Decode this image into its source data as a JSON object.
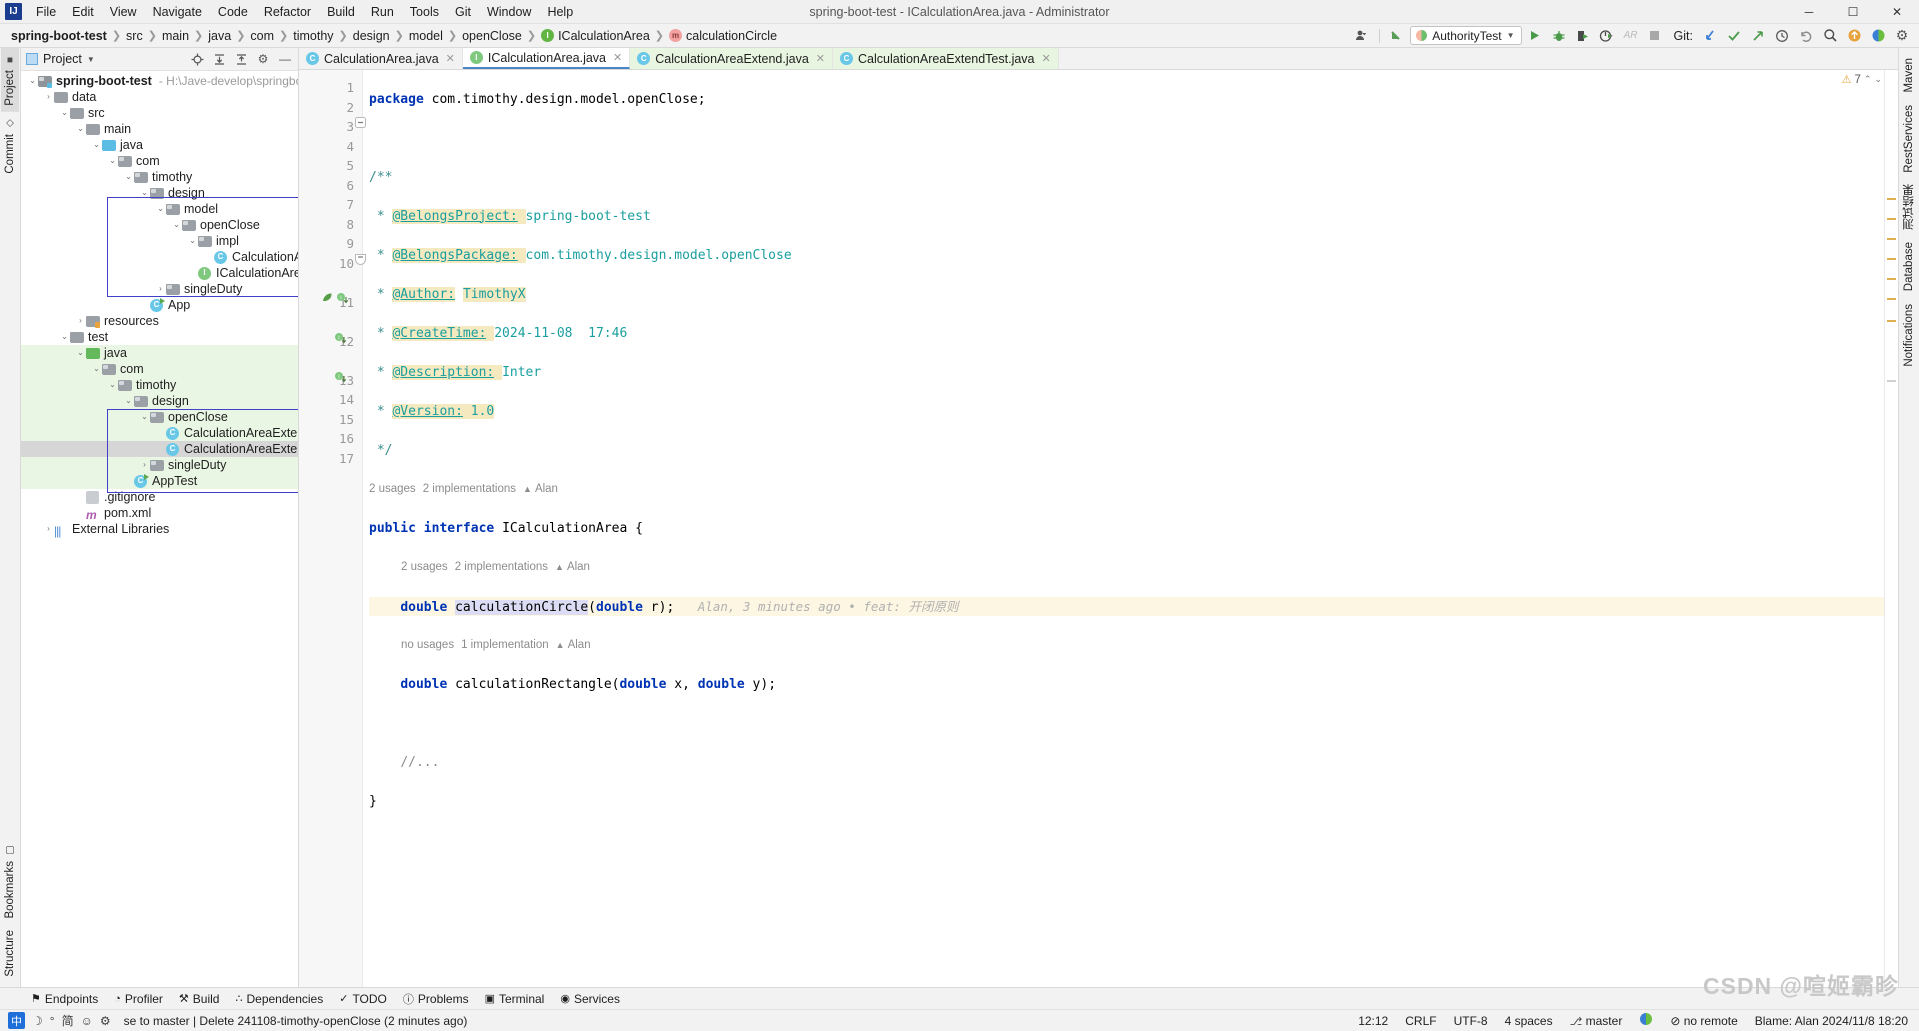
{
  "window": {
    "title": "spring-boot-test - ICalculationArea.java - Administrator",
    "logo": "IJ",
    "minimize": "─",
    "maximize": "☐",
    "close": "✕"
  },
  "menu": [
    "File",
    "Edit",
    "View",
    "Navigate",
    "Code",
    "Refactor",
    "Build",
    "Run",
    "Tools",
    "Git",
    "Window",
    "Help"
  ],
  "breadcrumb": [
    {
      "label": "spring-boot-test",
      "icon": "",
      "bold": true
    },
    {
      "label": "src",
      "icon": ""
    },
    {
      "label": "main",
      "icon": ""
    },
    {
      "label": "java",
      "icon": ""
    },
    {
      "label": "com",
      "icon": ""
    },
    {
      "label": "timothy",
      "icon": ""
    },
    {
      "label": "design",
      "icon": ""
    },
    {
      "label": "model",
      "icon": ""
    },
    {
      "label": "openClose",
      "icon": ""
    },
    {
      "label": "ICalculationArea",
      "icon": "I"
    },
    {
      "label": "calculationCircle",
      "icon": "m"
    }
  ],
  "toolbar": {
    "profile_icon": "person-dropdown-icon",
    "updates_icon": "update-project-icon",
    "run_config": "AuthorityTest",
    "run_icon": "▶",
    "debug_icon": "debug-icon",
    "run_coverage_icon": "run-with-coverage-icon",
    "profiler_icon": "profiler-icon",
    "attach_icon": "AR",
    "stop_icon": "■",
    "git_label": "Git:",
    "git_update_icon": "↙",
    "git_commit_icon": "✓",
    "git_push_icon": "↗",
    "git_history_icon": "◴",
    "git_rollback_icon": "↺",
    "search_icon": "⌕",
    "notification_icon": "↑",
    "ai_icon": "ai-assistant-icon",
    "settings_icon": "⚙"
  },
  "left_rail": {
    "top": [
      "Project",
      "Commit"
    ],
    "bottom": [
      "Bookmarks",
      "Structure"
    ]
  },
  "right_rail": [
    "Maven",
    "RestServices",
    "测试结果",
    "Database",
    "Notifications"
  ],
  "project_panel": {
    "title": "Project",
    "actions": [
      "locate-icon",
      "expand-all-icon",
      "collapse-all-icon",
      "settings-icon",
      "hide-icon"
    ],
    "tree": [
      {
        "depth": 0,
        "arrow": "⌄",
        "icon": "module-folder",
        "label": "spring-boot-test",
        "bold": true,
        "path": "- H:\\Jave-develop\\springboot\\sp"
      },
      {
        "depth": 1,
        "arrow": "›",
        "icon": "folder",
        "label": "data"
      },
      {
        "depth": 1,
        "arrow": "⌄",
        "icon": "folder",
        "label": "src"
      },
      {
        "depth": 2,
        "arrow": "⌄",
        "icon": "folder",
        "label": "main"
      },
      {
        "depth": 3,
        "arrow": "⌄",
        "icon": "source-folder",
        "label": "java"
      },
      {
        "depth": 4,
        "arrow": "⌄",
        "icon": "package",
        "label": "com"
      },
      {
        "depth": 5,
        "arrow": "⌄",
        "icon": "package",
        "label": "timothy"
      },
      {
        "depth": 6,
        "arrow": "⌄",
        "icon": "package",
        "label": "design"
      },
      {
        "depth": 7,
        "arrow": "⌄",
        "icon": "package",
        "label": "model"
      },
      {
        "depth": 8,
        "arrow": "⌄",
        "icon": "package",
        "label": "openClose"
      },
      {
        "depth": 9,
        "arrow": "⌄",
        "icon": "package",
        "label": "impl"
      },
      {
        "depth": 10,
        "arrow": "",
        "icon": "class",
        "label": "CalculationArea"
      },
      {
        "depth": 9,
        "arrow": "",
        "icon": "interface",
        "label": "ICalculationArea"
      },
      {
        "depth": 8,
        "arrow": "›",
        "icon": "package",
        "label": "singleDuty"
      },
      {
        "depth": 7,
        "arrow": "",
        "icon": "runnable-class",
        "label": "App"
      },
      {
        "depth": 3,
        "arrow": "›",
        "icon": "resource-folder",
        "label": "resources"
      },
      {
        "depth": 2,
        "arrow": "⌄",
        "icon": "folder",
        "label": "test"
      },
      {
        "depth": 3,
        "arrow": "⌄",
        "icon": "test-source-folder",
        "label": "java",
        "green": true
      },
      {
        "depth": 4,
        "arrow": "⌄",
        "icon": "package",
        "label": "com",
        "green": true
      },
      {
        "depth": 5,
        "arrow": "⌄",
        "icon": "package",
        "label": "timothy",
        "green": true
      },
      {
        "depth": 6,
        "arrow": "⌄",
        "icon": "package",
        "label": "design",
        "green": true
      },
      {
        "depth": 7,
        "arrow": "⌄",
        "icon": "package",
        "label": "openClose",
        "green": true
      },
      {
        "depth": 8,
        "arrow": "",
        "icon": "class",
        "label": "CalculationAreaExtend",
        "green": true
      },
      {
        "depth": 8,
        "arrow": "",
        "icon": "class",
        "label": "CalculationAreaExtendTest",
        "green": true,
        "selected": true
      },
      {
        "depth": 7,
        "arrow": "›",
        "icon": "package",
        "label": "singleDuty",
        "green": true
      },
      {
        "depth": 6,
        "arrow": "",
        "icon": "runnable-class",
        "label": "AppTest",
        "green": true
      },
      {
        "depth": 1,
        "arrow": "",
        "icon": "gitignore",
        "label": ".gitignore"
      },
      {
        "depth": 1,
        "arrow": "",
        "icon": "maven",
        "label": "pom.xml"
      },
      {
        "depth": 0,
        "arrow": "›",
        "icon": "libraries",
        "label": "External Libraries"
      }
    ]
  },
  "tabs": [
    {
      "label": "CalculationArea.java",
      "icon": "C",
      "kind": "class",
      "active": false,
      "test": false
    },
    {
      "label": "ICalculationArea.java",
      "icon": "I",
      "kind": "interface",
      "active": true,
      "test": false
    },
    {
      "label": "CalculationAreaExtend.java",
      "icon": "C",
      "kind": "class",
      "active": false,
      "test": true
    },
    {
      "label": "CalculationAreaExtendTest.java",
      "icon": "C",
      "kind": "class",
      "active": false,
      "test": true
    }
  ],
  "editor": {
    "warning_count": "7",
    "warning_icon": "⚠",
    "collapse_up_icon": "⌃",
    "collapse_down_icon": "⌄",
    "lines": [
      {
        "n": "1",
        "text": "package com.timothy.design.model.openClose;"
      },
      {
        "n": "2",
        "text": ""
      },
      {
        "n": "3",
        "text": "/**"
      },
      {
        "n": "4",
        "text": " * @BelongsProject: spring-boot-test"
      },
      {
        "n": "5",
        "text": " * @BelongsPackage: com.timothy.design.model.openClose"
      },
      {
        "n": "6",
        "text": " * @Author: TimothyX"
      },
      {
        "n": "7",
        "text": " * @CreateTime: 2024-11-08  17:46"
      },
      {
        "n": "8",
        "text": " * @Description: Inter"
      },
      {
        "n": "9",
        "text": " * @Version: 1.0"
      },
      {
        "n": "10",
        "text": " */"
      },
      {
        "n": "11",
        "text": "public interface ICalculationArea {"
      },
      {
        "n": "12",
        "text": "    double calculationCircle(double r);"
      },
      {
        "n": "13",
        "text": "    double calculationRectangle(double x, double y);"
      },
      {
        "n": "14",
        "text": ""
      },
      {
        "n": "15",
        "text": "    //..."
      },
      {
        "n": "16",
        "text": "}"
      },
      {
        "n": "17",
        "text": ""
      }
    ],
    "doc_tags": [
      {
        "tag": "@BelongsProject:",
        "value": "spring-boot-test"
      },
      {
        "tag": "@BelongsPackage:",
        "value": "com.timothy.design.model.openClose"
      },
      {
        "tag": "@Author:",
        "value": "TimothyX"
      },
      {
        "tag": "@CreateTime:",
        "value": "2024-11-08  17:46"
      },
      {
        "tag": "@Description:",
        "value": "Inter"
      },
      {
        "tag": "@Version:",
        "value": "1.0"
      }
    ],
    "code_vision": [
      {
        "usages": "2 usages",
        "impls": "2 implementations",
        "author": "Alan"
      },
      {
        "usages": "2 usages",
        "impls": "2 implementations",
        "author": "Alan"
      },
      {
        "usages": "no usages",
        "impls": "1 implementation",
        "author": "Alan"
      }
    ],
    "blame_annotation": "Alan, 3 minutes ago • feat: 开闭原则",
    "package_keyword": "package",
    "package_name": "com.timothy.design.model.openClose;",
    "sig_public": "public",
    "sig_interface": "interface",
    "sig_name": "ICalculationArea",
    "sig_brace": "{",
    "m1_type": "double",
    "m1_name": "calculationCircle",
    "m1_params_open": "(",
    "m1_param_type": "double",
    "m1_param_name": " r);",
    "m2_type": "double",
    "m2_name": "calculationRectangle(",
    "m2_p1_type": "double",
    "m2_p1_name": " x, ",
    "m2_p2_type": "double",
    "m2_p2_name": " y);",
    "comment_line": "//...",
    "close_brace": "}"
  },
  "bottom_tools": [
    {
      "label": "Endpoints",
      "icon": "⚑"
    },
    {
      "label": "Profiler",
      "icon": "◔"
    },
    {
      "label": "Build",
      "icon": "⚒"
    },
    {
      "label": "Dependencies",
      "icon": "∴"
    },
    {
      "label": "TODO",
      "icon": "✓"
    },
    {
      "label": "Problems",
      "icon": "ⓘ"
    },
    {
      "label": "Terminal",
      "icon": "▣"
    },
    {
      "label": "Services",
      "icon": "◉"
    }
  ],
  "statusbar": {
    "vcs_message": "se to master | Delete 241108-timothy-openClose (2 minutes ago)",
    "caret": "12:12",
    "line_sep": "CRLF",
    "encoding": "UTF-8",
    "indent": "4 spaces",
    "branch": "master",
    "branch_icon": "⎇",
    "remote": "no remote",
    "remote_icon": "⊘",
    "blame": "Blame: Alan 2024/11/8 18:20",
    "ime_lang": "中",
    "ime_shape": "简",
    "ime_moon": "☽",
    "ime_dot": "°",
    "ime_smiley": "☺",
    "ime_gear": "⚙",
    "ime_mic": "♪"
  },
  "watermark": "CSDN @喧姬霸昣",
  "colors": {
    "accent_blue": "#4a86c8",
    "keyword": "#0033b3",
    "javadoc": "#3a8c8c",
    "tag_highlight": "#f5e9c0",
    "line_highlight": "#fdf6e3",
    "test_green": "#eaf6e4",
    "selection_box": "#4040c8",
    "run_green": "#4a9a4a"
  }
}
